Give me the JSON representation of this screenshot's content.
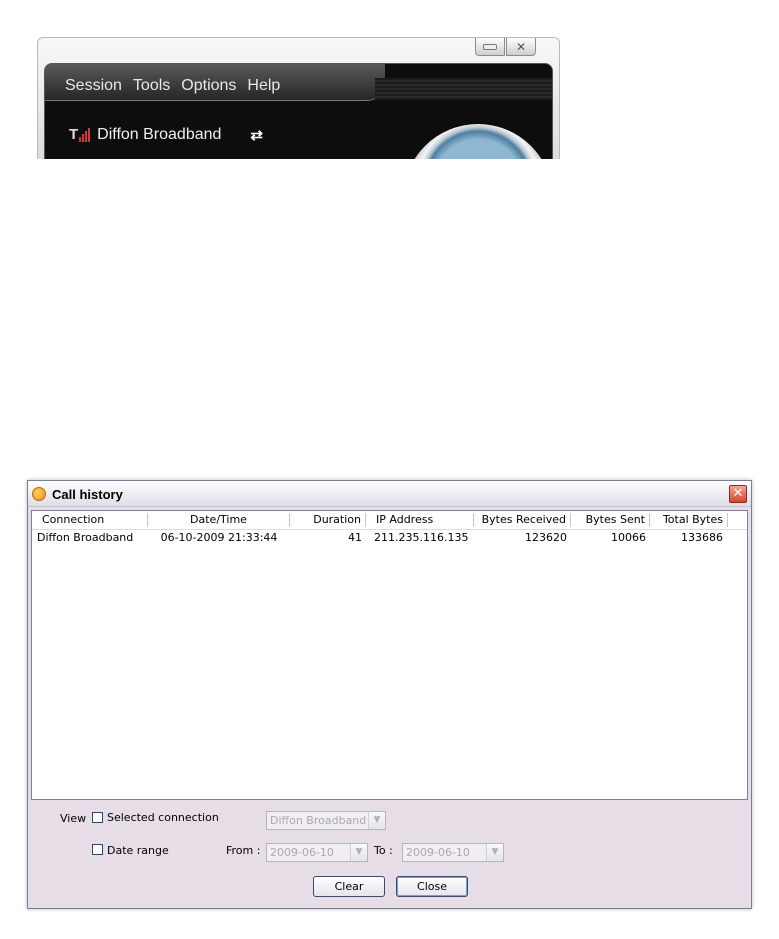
{
  "app": {
    "menu": [
      "Session",
      "Tools",
      "Options",
      "Help"
    ],
    "connection_name": "Diffon Broadband",
    "icons": {
      "signal": "signal-bars-icon",
      "swap": "swap-arrows-icon",
      "minimize": "minimize-icon",
      "close": "close-icon"
    }
  },
  "dialog": {
    "title": "Call history",
    "columns": [
      "Connection",
      "Date/Time",
      "Duration",
      "IP Address",
      "Bytes Received",
      "Bytes Sent",
      "Total Bytes"
    ],
    "rows": [
      {
        "connection": "Diffon Broadband",
        "datetime": "06-10-2009 21:33:44",
        "duration": "41",
        "ip": "211.235.116.135",
        "bytes_received": "123620",
        "bytes_sent": "10066",
        "total_bytes": "133686"
      }
    ],
    "filters": {
      "view_label": "View",
      "selected_connection_label": "Selected connection",
      "selected_connection_value": "Diffon Broadband",
      "date_range_label": "Date range",
      "from_label": "From :",
      "from_value": "2009-06-10",
      "to_label": "To :",
      "to_value": "2009-06-10"
    },
    "buttons": {
      "clear": "Clear",
      "close": "Close"
    }
  }
}
